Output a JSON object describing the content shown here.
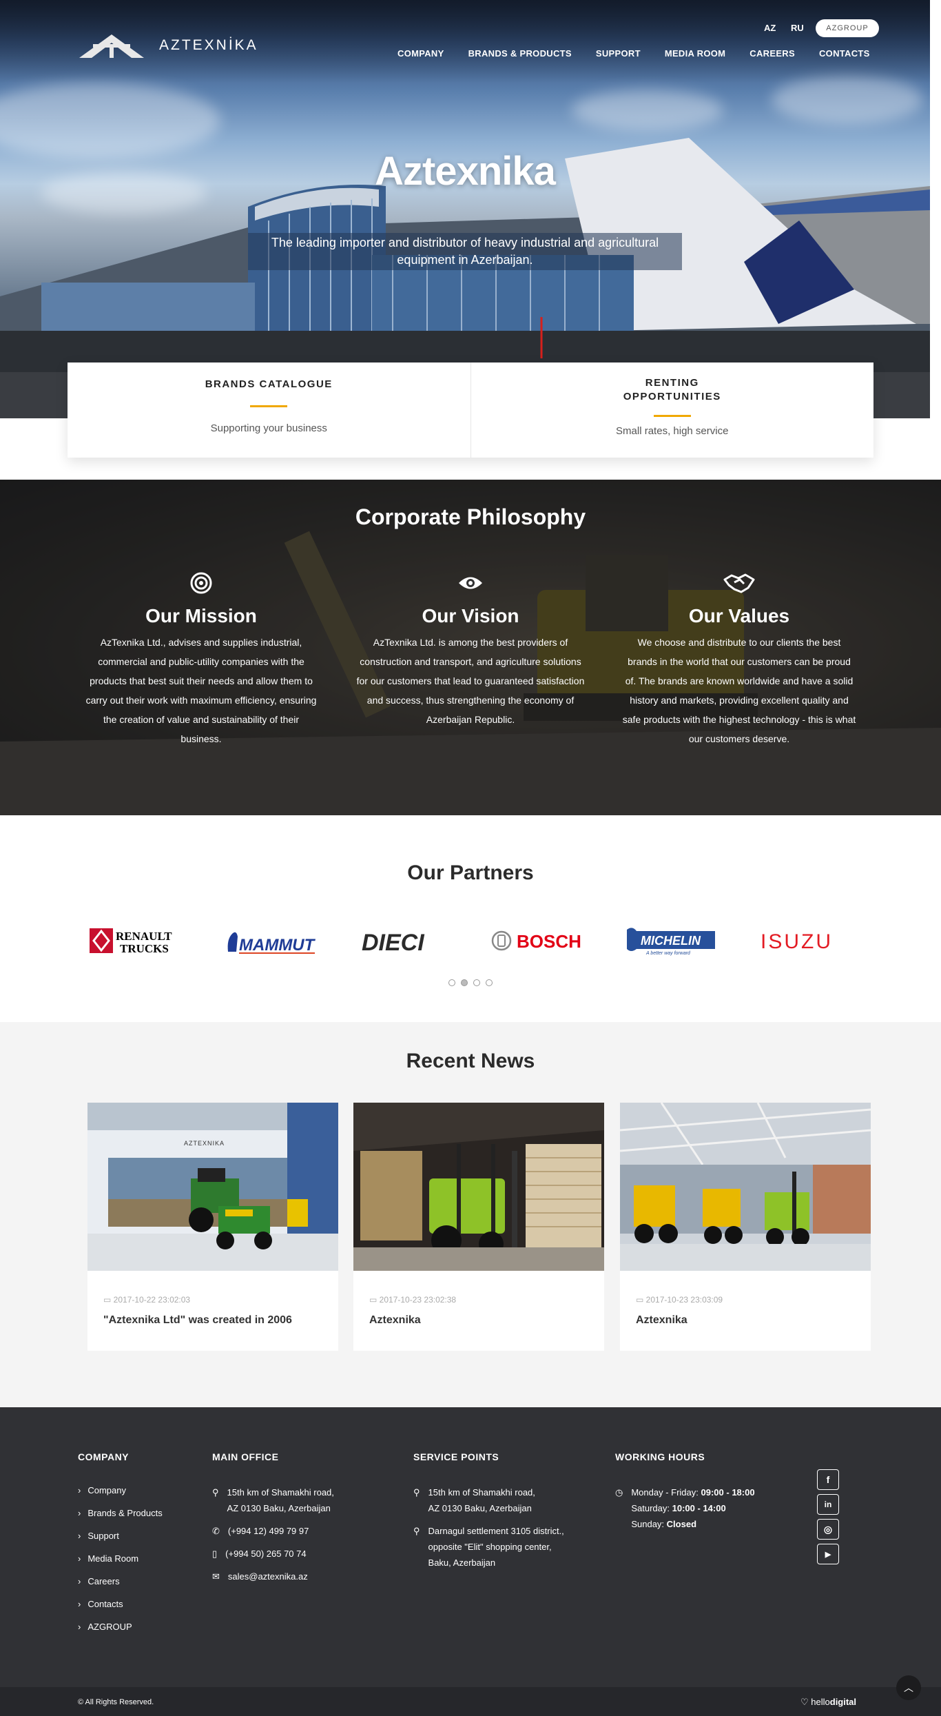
{
  "header": {
    "logo_text": "AZTEXNİKA",
    "lang": [
      "AZ",
      "RU"
    ],
    "azgroup_button": "AZGROUP",
    "nav": [
      "COMPANY",
      "BRANDS & PRODUCTS",
      "SUPPORT",
      "MEDIA ROOM",
      "CAREERS",
      "CONTACTS"
    ]
  },
  "hero": {
    "title": "Aztexnika",
    "subtitle": "The leading importer and distributor of heavy industrial and agricultural equipment in Azerbaijan."
  },
  "cards": [
    {
      "title": "BRANDS CATALOGUE",
      "subtitle": "Supporting your business"
    },
    {
      "title": "RENTING OPPORTUNITIES",
      "subtitle": "Small rates, high service"
    }
  ],
  "philosophy": {
    "title": "Corporate Philosophy",
    "columns": [
      {
        "icon": "target-icon",
        "title": "Our Mission",
        "text": "AzTexnika Ltd., advises and supplies industrial, commercial and public-utility companies with the products that best suit their needs and allow them to carry out their work with maximum efficiency, ensuring the creation of value and sustainability of their business."
      },
      {
        "icon": "eye-icon",
        "title": "Our Vision",
        "text": "AzTexnika Ltd. is among the best providers of construction and transport, and agriculture solutions for our customers that lead to guaranteed satisfaction and success, thus strengthening the economy of Azerbaijan Republic."
      },
      {
        "icon": "handshake-icon",
        "title": "Our Values",
        "text": "We choose and distribute to our clients the best brands in the world that our customers can be proud of. The brands are known worldwide and have a solid history and markets, providing excellent quality and safe products with the highest technology - this is what our customers deserve."
      }
    ]
  },
  "partners": {
    "title": "Our Partners",
    "logos": [
      {
        "name": "RENAULT TRUCKS",
        "line1": "RENAULT",
        "line2": "TRUCKS",
        "color": "#c8102e"
      },
      {
        "name": "MAMMUT",
        "color": "#1f3c96"
      },
      {
        "name": "DIECI",
        "color": "#2b2b2b"
      },
      {
        "name": "BOSCH",
        "color": "#e20015"
      },
      {
        "name": "MICHELIN",
        "tagline": "A better way forward",
        "color": "#27509b"
      },
      {
        "name": "ISUZU",
        "color": "#e31b23"
      }
    ],
    "dots": 4,
    "active_dot": 1
  },
  "news": {
    "title": "Recent News",
    "items": [
      {
        "date": "2017-10-22 23:02:03",
        "title": "\"Aztexnika Ltd\" was created in 2006",
        "image_sign": "AZTEXNIKA"
      },
      {
        "date": "2017-10-23 23:02:38",
        "title": "Aztexnika"
      },
      {
        "date": "2017-10-23 23:03:09",
        "title": "Aztexnika"
      }
    ]
  },
  "footer": {
    "company": {
      "heading": "COMPANY",
      "links": [
        "Company",
        "Brands & Products",
        "Support",
        "Media Room",
        "Careers",
        "Contacts",
        "AZGROUP"
      ]
    },
    "main_office": {
      "heading": "MAIN OFFICE",
      "address_line1": "15th km of Shamakhi road,",
      "address_line2": "AZ 0130 Baku, Azerbaijan",
      "phone": "(+994 12) 499 79 97",
      "mobile": "(+994 50) 265 70 74",
      "email": "sales@aztexnika.az"
    },
    "service_points": {
      "heading": "SERVICE POINTS",
      "p1_line1": "15th km of Shamakhi road,",
      "p1_line2": "AZ 0130 Baku, Azerbaijan",
      "p2_line1": "Darnagul settlement 3105 district.,",
      "p2_line2": "opposite \"Elit\" shopping center,",
      "p2_line3": "Baku, Azerbaijan"
    },
    "working_hours": {
      "heading": "WORKING HOURS",
      "weekday_label": "Monday - Friday:",
      "weekday_hours": "09:00 - 18:00",
      "saturday_label": "Saturday:",
      "saturday_hours": "10:00 - 14:00",
      "sunday_label": "Sunday:",
      "sunday_hours": "Closed"
    },
    "social": [
      "f",
      "in",
      "◎",
      "▶"
    ],
    "copyright": "© All Rights Reserved.",
    "credit_light": "hello",
    "credit_bold": "digital"
  }
}
